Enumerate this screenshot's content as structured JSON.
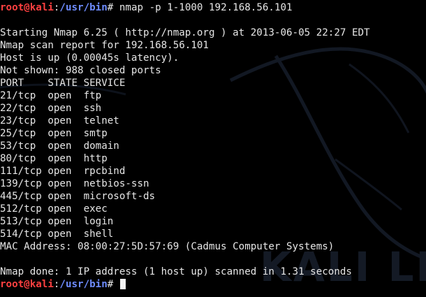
{
  "prompt": {
    "user_host": "root@kali",
    "colon": ":",
    "path": "/usr/bin",
    "symbol": "#"
  },
  "command": "nmap -p 1-1000 192.168.56.101",
  "output_lines": [
    "",
    "Starting Nmap 6.25 ( http://nmap.org ) at 2013-06-05 22:27 EDT",
    "Nmap scan report for 192.168.56.101",
    "Host is up (0.00045s latency).",
    "Not shown: 988 closed ports",
    "PORT    STATE SERVICE",
    "21/tcp  open  ftp",
    "22/tcp  open  ssh",
    "23/tcp  open  telnet",
    "25/tcp  open  smtp",
    "53/tcp  open  domain",
    "80/tcp  open  http",
    "111/tcp open  rpcbind",
    "139/tcp open  netbios-ssn",
    "445/tcp open  microsoft-ds",
    "512/tcp open  exec",
    "513/tcp open  login",
    "514/tcp open  shell",
    "MAC Address: 08:00:27:5D:57:69 (Cadmus Computer Systems)",
    "",
    "Nmap done: 1 IP address (1 host up) scanned in 1.31 seconds"
  ],
  "watermark": "KALI LIN",
  "colors": {
    "background": "#000000",
    "text": "#e6e6e6",
    "prompt_user": "#ff4040",
    "prompt_path": "#6e8cff",
    "watermark": "#141a25"
  },
  "icons": {
    "background_art": "kali-dragon-icon",
    "cursor": "block-cursor-icon"
  }
}
